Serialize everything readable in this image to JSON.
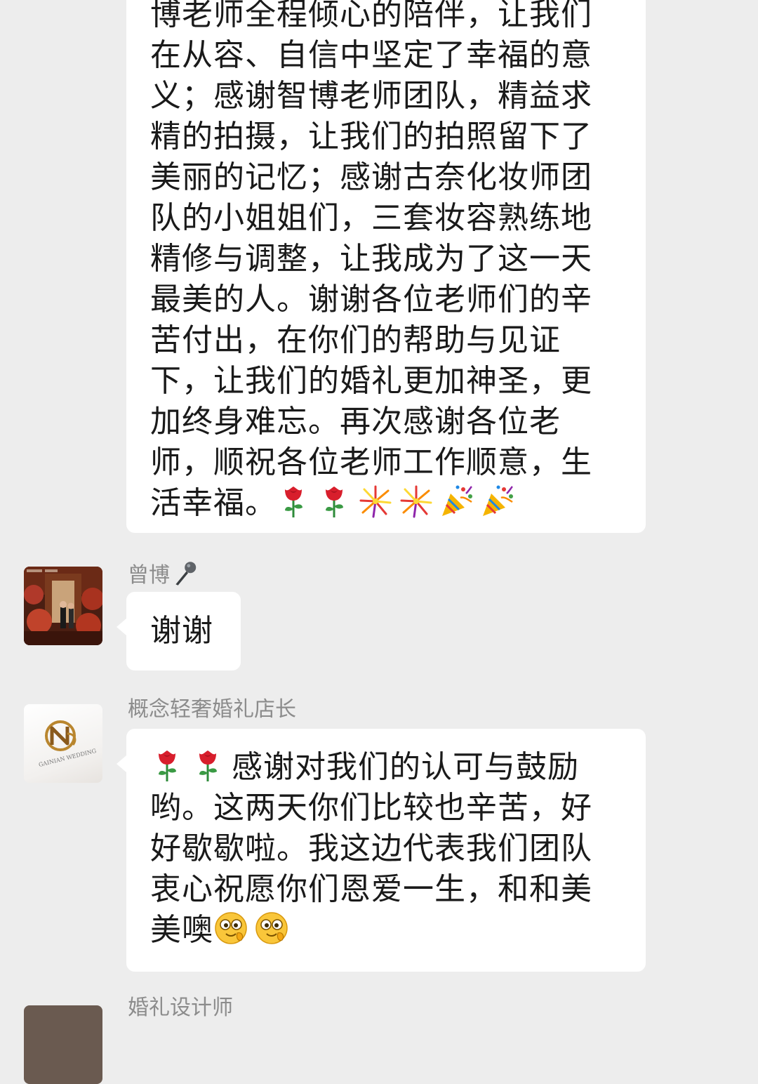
{
  "chat": {
    "messages": [
      {
        "id": "m1",
        "sender": "",
        "lines": [
          "博老师全程倾心的陪伴，让我们",
          "在从容、自信中坚定了幸福的意",
          "义；感谢智博老师团队，精益求",
          "精的拍摄，让我们的拍照留下了",
          "美丽的记忆；感谢古奈化妆师团",
          "队的小姐姐们，三套妆容熟练地",
          "精修与调整，让我成为了这一天",
          "最美的人。谢谢各位老师们的辛",
          "苦付出，在你们的帮助与见证",
          "下，让我们的婚礼更加神圣，更",
          "加终身难忘。再次感谢各位老",
          "师，顺祝各位老师工作顺意，生",
          "活幸福。"
        ],
        "trailing_emojis": [
          "rose-icon",
          "rose-icon",
          "fireworks-icon",
          "fireworks-icon",
          "party-popper-icon",
          "party-popper-icon"
        ]
      },
      {
        "id": "m2",
        "sender": "曾博",
        "sender_emoji": "microphone-icon",
        "text": "谢谢"
      },
      {
        "id": "m3",
        "sender": "概念轻奢婚礼店长",
        "leading_emojis": [
          "rose-icon",
          "rose-icon"
        ],
        "lines": [
          "感谢对我们的认可与鼓励",
          "哟。这两天你们比较也辛苦，好",
          "好歇歇啦。我这边代表我们团队",
          "衷心祝愿你们恩爱一生，和和美",
          "美噢"
        ],
        "trailing_emojis": [
          "smiling-face-icon",
          "smiling-face-icon"
        ],
        "avatar_logo_text": "GAINIAN WEDDING"
      },
      {
        "id": "m4",
        "sender": "婚礼设计师"
      }
    ]
  },
  "colors": {
    "background": "#ededed",
    "bubble": "#ffffff",
    "text": "#1a1a1a",
    "sender": "#8c8c8c",
    "rose": "#d81e2c",
    "stem": "#2e8b3a",
    "logo_gold": "#b9862f"
  }
}
